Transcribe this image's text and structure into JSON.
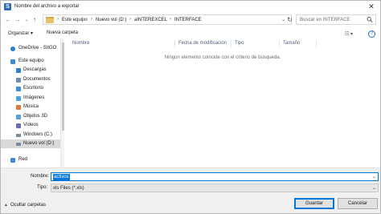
{
  "window": {
    "title": "Nombre del archivo a exportar",
    "close_glyph": "✕",
    "app_icon_letter": "S"
  },
  "nav": {
    "back_glyph": "←",
    "forward_glyph": "→",
    "recent_glyph": "⌄",
    "up_glyph": "↑",
    "refresh_glyph": "↻"
  },
  "breadcrumb": {
    "items": [
      "Este equipo",
      "Nuevo vol (D:)",
      "aINTEREXCEL",
      "INTERFACE"
    ],
    "separator": "›",
    "dropdown_glyph": "⌄"
  },
  "search": {
    "placeholder": "Buscar en INTERFACE"
  },
  "toolbar": {
    "organize_label": "Organizar ▾",
    "new_folder_label": "Nueva carpeta",
    "view_glyph": "☷ ▾",
    "help_glyph": "?"
  },
  "sidebar": {
    "items": [
      {
        "label": "OneDrive - SIIGO",
        "icon": "cloud-icon",
        "color": "#2b7cd3"
      },
      {
        "label": "Este equipo",
        "icon": "computer-icon",
        "color": "#3c8ad8"
      },
      {
        "label": "Descargas",
        "icon": "downloads-icon",
        "color": "#2f80d1"
      },
      {
        "label": "Documentos",
        "icon": "documents-icon",
        "color": "#6f8fb0"
      },
      {
        "label": "Escritorio",
        "icon": "desktop-icon",
        "color": "#3a8fd9"
      },
      {
        "label": "Imágenes",
        "icon": "pictures-icon",
        "color": "#4aa3df"
      },
      {
        "label": "Música",
        "icon": "music-icon",
        "color": "#e0783c"
      },
      {
        "label": "Objetos 3D",
        "icon": "objects-3d-icon",
        "color": "#5aa0d8"
      },
      {
        "label": "Vídeos",
        "icon": "videos-icon",
        "color": "#6b6bb5"
      },
      {
        "label": "Windows (C:)",
        "icon": "drive-icon",
        "color": "#7a8a99"
      },
      {
        "label": "Nuevo vol (D:)",
        "icon": "drive-icon",
        "color": "#7a8a99"
      },
      {
        "label": "Red",
        "icon": "network-icon",
        "color": "#3c8ad8"
      }
    ]
  },
  "file_list": {
    "columns": [
      "Nombre",
      "Fecha de modificación",
      "Tipo",
      "Tamaño"
    ],
    "empty_message": "Ningún elemento coincide con el criterio de búsqueda."
  },
  "form": {
    "name_label": "Nombre:",
    "name_value": "activos",
    "type_label": "Tipo:",
    "type_value": "xls Files (*.xls)",
    "dropdown_glyph": "⌄"
  },
  "footer": {
    "hide_folders_label": "Ocultar carpetas",
    "hide_caret": "▲",
    "save_label": "Guardar",
    "cancel_label": "Cancelar"
  }
}
